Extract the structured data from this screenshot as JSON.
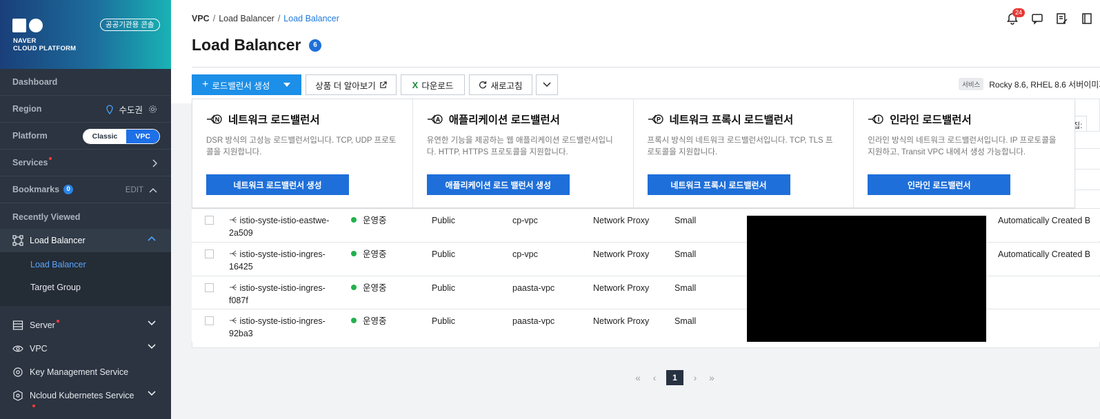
{
  "brand": {
    "logo_line1": "NAVER",
    "logo_line2": "CLOUD PLATFORM",
    "gov_badge": "공공기관용 콘솔"
  },
  "sidebar": {
    "dashboard": "Dashboard",
    "region_label": "Region",
    "region_value": "수도권",
    "platform_label": "Platform",
    "platform_options": [
      "Classic",
      "VPC"
    ],
    "platform_selected": "VPC",
    "services": "Services",
    "bookmarks": "Bookmarks",
    "bookmarks_count": "0",
    "bookmarks_edit": "EDIT",
    "recently_viewed": "Recently Viewed",
    "menu": [
      {
        "label": "Load Balancer",
        "icon": "load-balancer-icon",
        "expanded": true
      },
      {
        "label": "Server",
        "icon": "server-icon",
        "expanded": false
      },
      {
        "label": "VPC",
        "icon": "vpc-icon",
        "expanded": false
      },
      {
        "label": "Key Management Service",
        "icon": "key-icon",
        "expanded": false
      },
      {
        "label": "Ncloud Kubernetes Service",
        "icon": "kubernetes-icon",
        "expanded": false
      }
    ],
    "submenu": [
      {
        "label": "Load Balancer",
        "current": true
      },
      {
        "label": "Target Group",
        "current": false
      }
    ]
  },
  "header": {
    "breadcrumb": [
      "VPC",
      "Load Balancer",
      "Load Balancer"
    ],
    "title": "Load Balancer",
    "title_count": "6",
    "notification_count": "24"
  },
  "toolbar": {
    "create_label": "로드밸런서 생성",
    "learn_more_label": "상품 더 알아보기",
    "download_label": "다운로드",
    "refresh_label": "새로고침",
    "service_tag": "서비스",
    "service_note": "Rocky 8.6, RHEL 8.6 서버이미지("
  },
  "lb_types": [
    {
      "icon_letter": "N",
      "title": "네트워크 로드밸런서",
      "desc": "DSR 방식의 고성능 로드밸런서입니다. TCP, UDP 프로토콜을 지원합니다.",
      "button": "네트워크 로드밸런서 생성"
    },
    {
      "icon_letter": "A",
      "title": "애플리케이션 로드밸런서",
      "desc": "유연한 기능을 제공하는 웹 애플리케이션 로드밸런서입니다. HTTP, HTTPS 프로토콜을 지원합니다.",
      "button": "애플리케이션 로드 밸런서 생성"
    },
    {
      "icon_letter": "P",
      "title": "네트워크 프록시 로드밸런서",
      "desc": "프록시 방식의 네트워크 로드밸런서입니다. TCP, TLS 프로토콜을 지원합니다.",
      "button": "네트워크 프록시 로드밸런서"
    },
    {
      "icon_letter": "I",
      "title": "인라인 로드밸런서",
      "desc": "인라인 방식의 네트워크 로드밸런서입니다. IP 프로토콜을 지원하고, Transit VPC 내에서 생성 가능합니다.",
      "button": "인라인 로드밸런서"
    }
  ],
  "table_side_label": "수집:",
  "rows": [
    {
      "name1": "istio-syste-istio-eastwe-",
      "name2": "2a509",
      "status": "운영중",
      "network": "Public",
      "vpc": "cp-vpc",
      "type": "Network Proxy",
      "size": "Small",
      "desc": "Automatically Created B"
    },
    {
      "name1": "istio-syste-istio-ingres-",
      "name2": "16425",
      "status": "운영중",
      "network": "Public",
      "vpc": "cp-vpc",
      "type": "Network Proxy",
      "size": "Small",
      "desc": "Automatically Created B"
    },
    {
      "name1": "istio-syste-istio-ingres-",
      "name2": "f087f",
      "status": "운영중",
      "network": "Public",
      "vpc": "paasta-vpc",
      "type": "Network Proxy",
      "size": "Small",
      "desc": ""
    },
    {
      "name1": "istio-syste-istio-ingres-",
      "name2": "92ba3",
      "status": "운영중",
      "network": "Public",
      "vpc": "paasta-vpc",
      "type": "Network Proxy",
      "size": "Small",
      "desc": ""
    }
  ],
  "pagination": {
    "current": "1"
  },
  "colors": {
    "primary": "#1e6fd9",
    "accent_blue": "#1c8fe8",
    "status_green": "#22b14c",
    "sidebar_bg": "#2b3440"
  }
}
